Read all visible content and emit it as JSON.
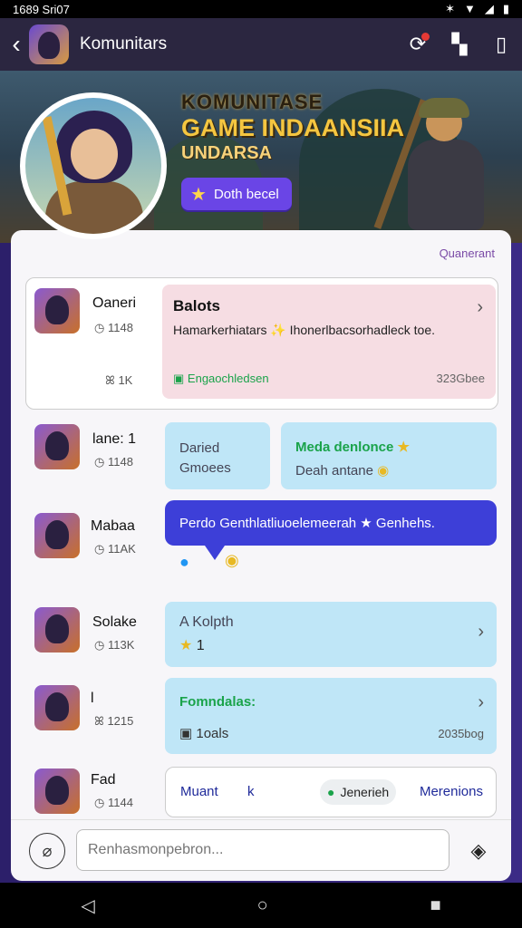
{
  "status": {
    "time": "1689 Sri07",
    "icons": [
      "bluetooth",
      "wifi",
      "signal",
      "battery"
    ]
  },
  "appbar": {
    "back_icon": "chevron-left-icon",
    "title": "Komunitars",
    "actions": [
      "notification-icon",
      "bookmark-icon",
      "phone-icon"
    ]
  },
  "hero": {
    "kicker": "KOMUNITASE",
    "headline": "GAME INDAANSIIA",
    "sub": "UNDARSA",
    "cta_label": "Doth becel"
  },
  "panel": {
    "sort_label": "Quanerant"
  },
  "rows": [
    {
      "name": "Oaneri",
      "meta1": "1148",
      "meta2": "1K"
    },
    {
      "name": "lane: 1",
      "meta1": "1148"
    },
    {
      "name": "Mabaa",
      "meta1": "11AK"
    },
    {
      "name": "Solake",
      "meta1": "113K"
    },
    {
      "name": "l",
      "meta1": "1215"
    },
    {
      "name": "Fad",
      "meta1": "1144"
    }
  ],
  "post1": {
    "title": "Balots",
    "body": "Hamarkerhiatars ✨ Ihonerlbacsorhadleck toe.",
    "tag": "Engaochledsen",
    "time": "323Gbee"
  },
  "row2": {
    "left": "Daried Gmoees",
    "right_highlight": "Meda denlonce",
    "right_rest": "Deah antane"
  },
  "row3": {
    "bubble": "Perdo Genthlatliuoelemeerah ★ Genhehs."
  },
  "row4": {
    "title": "A Kolpth",
    "count": "1"
  },
  "row5": {
    "title": "Fomndalas:",
    "sub": "1oals",
    "time": "2035bog"
  },
  "row6": {
    "a": "Muant",
    "b": "k",
    "chip": "Jenerieh",
    "d": "Merenions"
  },
  "composer": {
    "placeholder": "Renhasmonpebron..."
  },
  "nav": [
    "back",
    "home",
    "recents"
  ]
}
